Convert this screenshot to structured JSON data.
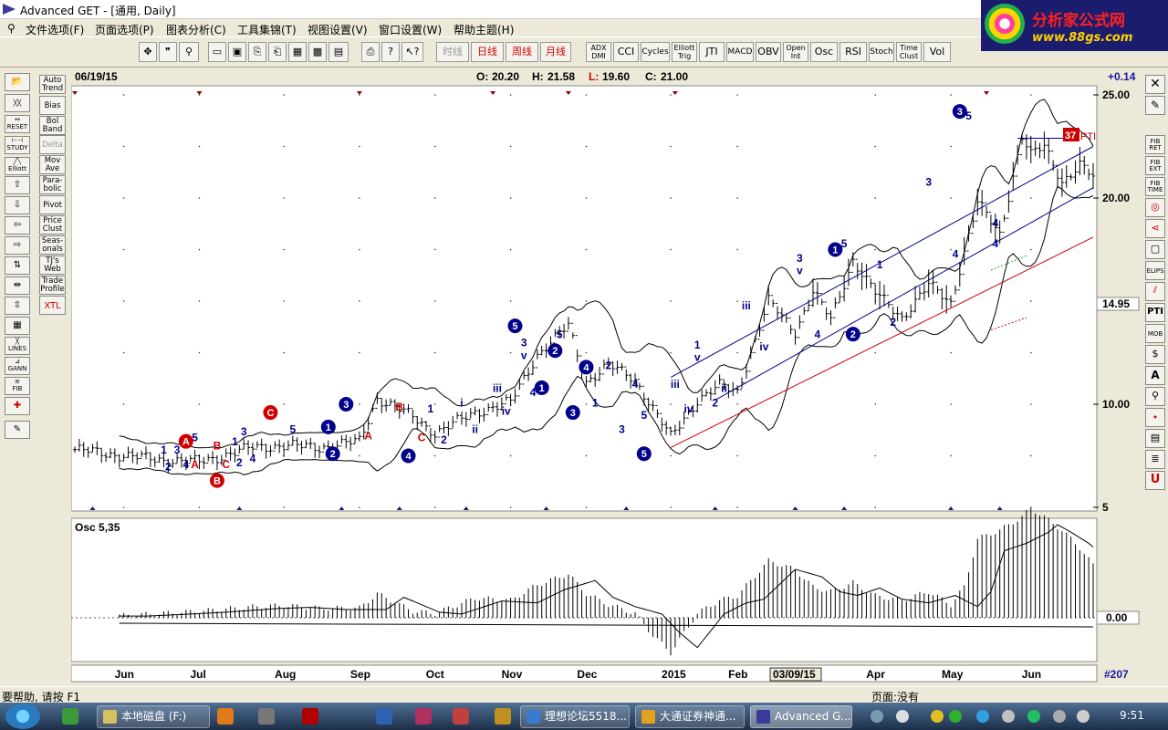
{
  "window": {
    "title": "Advanced GET - [通用, Daily]"
  },
  "logo": {
    "brand": "分析家公式网",
    "url": "www.88gs.com"
  },
  "menu": [
    "文件选项(F)",
    "页面选项(P)",
    "图表分析(C)",
    "工具集锦(T)",
    "视图设置(V)",
    "窗口设置(W)",
    "帮助主题(H)"
  ],
  "toolbar": {
    "period_buttons": [
      "时线",
      "日线",
      "周线",
      "月线"
    ],
    "indicator_buttons": [
      "ADX DMI",
      "CCI",
      "Cycles",
      "Elliott Trig",
      "JTI",
      "MACD",
      "OBV",
      "Open Int",
      "Osc",
      "RSI",
      "Stoch",
      "Time Clust",
      "Vol"
    ]
  },
  "left_tools": [
    "Auto Trend",
    "Bias",
    "Bol Band",
    "Delta",
    "Mov Ave",
    "Para-bolic",
    "Pivot",
    "Price Clust",
    "Seas-onals",
    "TJ's Web",
    "Trade Profile",
    "XTL"
  ],
  "left_icons": [
    "RESET",
    "STUDY",
    "Elliott",
    "LINES",
    "GANN",
    "FIB"
  ],
  "right_tools": [
    "FIB RET",
    "FIB EXT",
    "FIB TIME",
    "ELIPS",
    "PTI",
    "MOB"
  ],
  "header": {
    "date": "06/19/15",
    "open_label": "O:",
    "open": "20.20",
    "high_label": "H:",
    "high": "21.58",
    "low_label": "L:",
    "low": "19.60",
    "close_label": "C:",
    "close": "21.00",
    "change": "+0.14"
  },
  "annotations": {
    "pti_value": "37",
    "pti_label": "PTI",
    "current_price_tag": "14.95",
    "osc_zero_tag": "0.00",
    "bar_count": "#207",
    "date_cursor": "03/09/15",
    "osc_title": "Osc 5,35"
  },
  "colors": {
    "price_bar": "#000000",
    "wave_primary": "#00008b",
    "wave_secondary": "#d00000",
    "channel": "#00008b",
    "support": "#d00000",
    "bollinger": "#000000"
  },
  "chart_data": {
    "type": "line",
    "title": "",
    "xlabel": "",
    "ylabel": "",
    "ylim": [
      5,
      25
    ],
    "y_ticks": [
      "25.00",
      "20.00",
      "10.00",
      "5"
    ],
    "x_month_labels": [
      "Jun",
      "Jul",
      "Aug",
      "Sep",
      "Oct",
      "Nov",
      "Dec",
      "2015",
      "Feb",
      "Apr",
      "May",
      "Jun"
    ],
    "x_month_index": [
      11,
      28,
      47,
      64,
      81,
      98,
      115,
      134,
      149,
      180,
      197,
      215
    ],
    "series": [
      {
        "index": [
          0,
          11,
          20,
          28,
          40,
          47,
          55,
          64,
          68,
          76,
          81,
          90,
          98,
          104,
          111,
          115,
          120,
          126,
          130,
          134,
          140,
          145,
          149,
          156,
          162,
          166,
          170,
          175,
          180,
          186,
          192,
          197,
          200,
          203,
          208,
          213,
          215,
          218,
          222,
          226,
          229
        ],
        "values": [
          7.8,
          7.5,
          7.3,
          7.2,
          7.9,
          8.0,
          7.9,
          8.2,
          10.3,
          9.4,
          8.6,
          9.6,
          10.1,
          12.4,
          13.8,
          11.1,
          11.9,
          11.2,
          9.8,
          8.4,
          10.2,
          10.9,
          10.6,
          15.0,
          13.5,
          15.5,
          14.1,
          17.0,
          15.4,
          14.2,
          15.8,
          14.9,
          17.4,
          19.8,
          18.2,
          23.0,
          22.1,
          22.5,
          20.8,
          21.6,
          21.0
        ]
      }
    ],
    "oscillator": {
      "title": "Osc 5,35",
      "zero_label": "0.00",
      "index": [
        0,
        11,
        20,
        28,
        40,
        47,
        55,
        64,
        68,
        76,
        81,
        90,
        98,
        104,
        111,
        115,
        120,
        126,
        130,
        134,
        140,
        145,
        149,
        156,
        162,
        166,
        170,
        175,
        180,
        186,
        192,
        197,
        200,
        203,
        208,
        213,
        215,
        218,
        222,
        226,
        229
      ],
      "values": [
        0.0,
        0.05,
        0.1,
        0.15,
        0.25,
        0.28,
        0.22,
        0.22,
        0.55,
        0.15,
        0.1,
        0.45,
        0.4,
        0.75,
        1.0,
        0.55,
        0.3,
        0.1,
        -0.4,
        -0.8,
        0.1,
        0.4,
        0.5,
        1.3,
        1.1,
        0.7,
        0.6,
        0.8,
        0.5,
        0.4,
        0.6,
        0.3,
        0.7,
        1.8,
        2.0,
        2.3,
        2.5,
        2.3,
        2.0,
        1.6,
        1.2
      ]
    },
    "elliott_labels": [
      {
        "t": "1",
        "x": 20,
        "y": 7.6,
        "c": "primary"
      },
      {
        "t": "2",
        "x": 21,
        "y": 6.8,
        "c": "primary"
      },
      {
        "t": "3",
        "x": 23,
        "y": 7.6,
        "c": "primary"
      },
      {
        "t": "4",
        "x": 25,
        "y": 6.9,
        "c": "primary"
      },
      {
        "t": "5",
        "x": 27,
        "y": 8.2,
        "c": "primary"
      },
      {
        "t": "A",
        "x": 27,
        "y": 6.9,
        "c": "secondary"
      },
      {
        "t": "B",
        "x": 32,
        "y": 7.8,
        "c": "secondary"
      },
      {
        "t": "C",
        "x": 34,
        "y": 6.9,
        "c": "secondary"
      },
      {
        "t": "1",
        "x": 36,
        "y": 8.0,
        "c": "primary"
      },
      {
        "t": "2",
        "x": 37,
        "y": 7.0,
        "c": "primary"
      },
      {
        "t": "3",
        "x": 38,
        "y": 8.5,
        "c": "primary"
      },
      {
        "t": "4",
        "x": 40,
        "y": 7.2,
        "c": "primary"
      },
      {
        "t": "5",
        "x": 49,
        "y": 8.6,
        "c": "primary"
      },
      {
        "t": "A",
        "x": 66,
        "y": 8.3,
        "c": "secondary"
      },
      {
        "t": "B",
        "x": 73,
        "y": 9.7,
        "c": "secondary"
      },
      {
        "t": "C",
        "x": 78,
        "y": 8.2,
        "c": "secondary"
      },
      {
        "t": "1",
        "x": 80,
        "y": 9.6,
        "c": "primary"
      },
      {
        "t": "2",
        "x": 83,
        "y": 8.1,
        "c": "primary"
      },
      {
        "t": "i",
        "x": 87,
        "y": 9.9,
        "c": "primary"
      },
      {
        "t": "ii",
        "x": 90,
        "y": 8.6,
        "c": "primary"
      },
      {
        "t": "iii",
        "x": 95,
        "y": 10.6,
        "c": "primary"
      },
      {
        "t": "iv",
        "x": 97,
        "y": 9.5,
        "c": "primary"
      },
      {
        "t": "v",
        "x": 101,
        "y": 12.2,
        "c": "primary"
      },
      {
        "t": "3",
        "x": 101,
        "y": 12.8,
        "c": "primary"
      },
      {
        "t": "4",
        "x": 103,
        "y": 10.4,
        "c": "primary"
      },
      {
        "t": "5",
        "x": 109,
        "y": 13.2,
        "c": "primary"
      },
      {
        "t": "1",
        "x": 117,
        "y": 9.9,
        "c": "primary"
      },
      {
        "t": "2",
        "x": 120,
        "y": 11.7,
        "c": "primary"
      },
      {
        "t": "3",
        "x": 123,
        "y": 8.6,
        "c": "primary"
      },
      {
        "t": "4",
        "x": 126,
        "y": 10.8,
        "c": "primary"
      },
      {
        "t": "5",
        "x": 128,
        "y": 9.3,
        "c": "primary"
      },
      {
        "t": "1",
        "x": 140,
        "y": 12.7,
        "c": "primary"
      },
      {
        "t": "v",
        "x": 140,
        "y": 12.1,
        "c": "primary"
      },
      {
        "t": "iii",
        "x": 135,
        "y": 10.8,
        "c": "primary"
      },
      {
        "t": "iv",
        "x": 138,
        "y": 9.6,
        "c": "primary"
      },
      {
        "t": "ii",
        "x": 146,
        "y": 10.6,
        "c": "primary"
      },
      {
        "t": "2",
        "x": 144,
        "y": 9.9,
        "c": "primary"
      },
      {
        "t": "iii",
        "x": 151,
        "y": 14.6,
        "c": "primary"
      },
      {
        "t": "iv",
        "x": 155,
        "y": 12.6,
        "c": "primary"
      },
      {
        "t": "3",
        "x": 163,
        "y": 16.9,
        "c": "primary"
      },
      {
        "t": "v",
        "x": 163,
        "y": 16.3,
        "c": "primary"
      },
      {
        "t": "4",
        "x": 167,
        "y": 13.2,
        "c": "primary"
      },
      {
        "t": "5",
        "x": 173,
        "y": 17.6,
        "c": "primary"
      },
      {
        "t": "1",
        "x": 181,
        "y": 16.6,
        "c": "primary"
      },
      {
        "t": "2",
        "x": 184,
        "y": 13.8,
        "c": "primary"
      },
      {
        "t": "3",
        "x": 192,
        "y": 20.6,
        "c": "primary"
      },
      {
        "t": "4",
        "x": 198,
        "y": 17.1,
        "c": "primary"
      },
      {
        "t": "5",
        "x": 201,
        "y": 23.8,
        "c": "primary"
      },
      {
        "t": "4",
        "x": 207,
        "y": 18.6,
        "c": "primary"
      },
      {
        "t": "4",
        "x": 207,
        "y": 17.6,
        "c": "primary"
      }
    ],
    "wave_circles": [
      {
        "t": "A",
        "x": 25,
        "y": 8.2,
        "c": "secondary"
      },
      {
        "t": "B",
        "x": 32,
        "y": 6.3,
        "c": "secondary"
      },
      {
        "t": "C",
        "x": 44,
        "y": 9.6,
        "c": "secondary"
      },
      {
        "t": "1",
        "x": 57,
        "y": 8.9,
        "c": "primary"
      },
      {
        "t": "2",
        "x": 58,
        "y": 7.6,
        "c": "primary"
      },
      {
        "t": "3",
        "x": 61,
        "y": 10.0,
        "c": "primary"
      },
      {
        "t": "4",
        "x": 75,
        "y": 7.5,
        "c": "primary"
      },
      {
        "t": "5",
        "x": 99,
        "y": 13.8,
        "c": "primary"
      },
      {
        "t": "1",
        "x": 105,
        "y": 10.8,
        "c": "primary"
      },
      {
        "t": "2",
        "x": 108,
        "y": 12.6,
        "c": "primary"
      },
      {
        "t": "3",
        "x": 112,
        "y": 9.6,
        "c": "primary"
      },
      {
        "t": "4",
        "x": 115,
        "y": 11.8,
        "c": "primary"
      },
      {
        "t": "5",
        "x": 128,
        "y": 7.6,
        "c": "primary"
      },
      {
        "t": "1",
        "x": 171,
        "y": 17.5,
        "c": "primary"
      },
      {
        "t": "2",
        "x": 175,
        "y": 13.4,
        "c": "primary"
      },
      {
        "t": "3",
        "x": 199,
        "y": 24.2,
        "c": "primary"
      }
    ]
  }
}
